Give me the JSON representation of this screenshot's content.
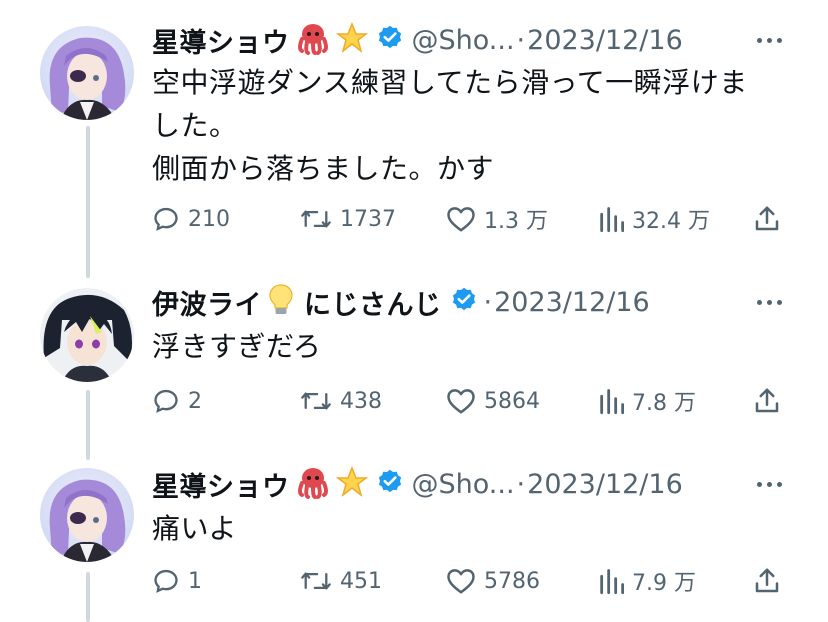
{
  "tweets": [
    {
      "author": "星導ショウ",
      "emoji_1": "octopus-emoji",
      "emoji_2": "star-emoji",
      "handle": "@Sho...",
      "separator": "·",
      "date": "2023/12/16",
      "text_lines": [
        "空中浮遊ダンス練習してたら滑って一瞬浮けま",
        "した。",
        "側面から落ちました。かす"
      ],
      "replies": "210",
      "retweets": "1737",
      "likes": "1.3 万",
      "views": "32.4 万"
    },
    {
      "author": "伊波ライ",
      "emoji_1": "lightbulb-emoji",
      "author_suffix": "にじさんじ",
      "separator": "·",
      "date": "2023/12/16",
      "text_lines": [
        "浮きすぎだろ"
      ],
      "replies": "2",
      "retweets": "438",
      "likes": "5864",
      "views": "7.8 万"
    },
    {
      "author": "星導ショウ",
      "emoji_1": "octopus-emoji",
      "emoji_2": "star-emoji",
      "handle": "@Sho...",
      "separator": "·",
      "date": "2023/12/16",
      "text_lines": [
        "痛いよ"
      ],
      "replies": "1",
      "retweets": "451",
      "likes": "5786",
      "views": "7.9 万"
    }
  ],
  "colors": {
    "text": "#0f1419",
    "secondary": "#536471",
    "verified_blue": "#1d9bf0",
    "thread_line": "#cfd9de"
  }
}
